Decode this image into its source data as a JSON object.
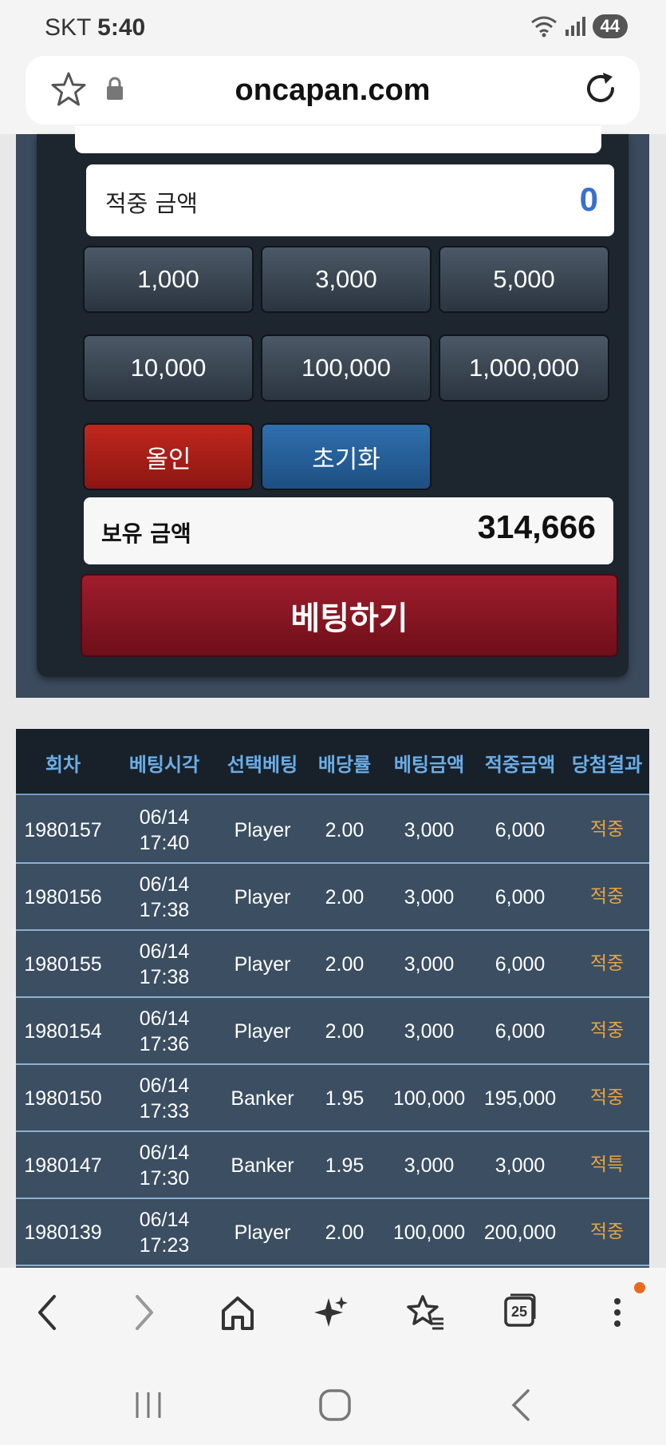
{
  "status": {
    "carrier": "SKT",
    "time": "5:40",
    "battery": "44"
  },
  "browser": {
    "domain": "oncapan.com"
  },
  "bet": {
    "win_label": "적중 금액",
    "win_value": "0",
    "chips": [
      "1,000",
      "3,000",
      "5,000",
      "10,000",
      "100,000",
      "1,000,000"
    ],
    "allin_label": "올인",
    "reset_label": "초기화",
    "balance_label": "보유 금액",
    "balance_value": "314,666",
    "bet_button": "베팅하기"
  },
  "history": {
    "headers": [
      "회차",
      "베팅시각",
      "선택베팅",
      "배당률",
      "베팅금액",
      "적중금액",
      "당첨결과"
    ],
    "rows": [
      {
        "round": "1980157",
        "date": "06/14",
        "time": "17:40",
        "pick": "Player",
        "odds": "2.00",
        "bet": "3,000",
        "win": "6,000",
        "result": "적중"
      },
      {
        "round": "1980156",
        "date": "06/14",
        "time": "17:38",
        "pick": "Player",
        "odds": "2.00",
        "bet": "3,000",
        "win": "6,000",
        "result": "적중"
      },
      {
        "round": "1980155",
        "date": "06/14",
        "time": "17:38",
        "pick": "Player",
        "odds": "2.00",
        "bet": "3,000",
        "win": "6,000",
        "result": "적중"
      },
      {
        "round": "1980154",
        "date": "06/14",
        "time": "17:36",
        "pick": "Player",
        "odds": "2.00",
        "bet": "3,000",
        "win": "6,000",
        "result": "적중"
      },
      {
        "round": "1980150",
        "date": "06/14",
        "time": "17:33",
        "pick": "Banker",
        "odds": "1.95",
        "bet": "100,000",
        "win": "195,000",
        "result": "적중"
      },
      {
        "round": "1980147",
        "date": "06/14",
        "time": "17:30",
        "pick": "Banker",
        "odds": "1.95",
        "bet": "3,000",
        "win": "3,000",
        "result": "적특"
      },
      {
        "round": "1980139",
        "date": "06/14",
        "time": "17:23",
        "pick": "Player",
        "odds": "2.00",
        "bet": "100,000",
        "win": "200,000",
        "result": "적중"
      }
    ]
  },
  "nav": {
    "tabs_count": "25"
  },
  "colors": {
    "accent_blue": "#3a6fd0",
    "result_orange": "#e8a440",
    "header_blue": "#6aaee8",
    "bet_red": "#a01d2c"
  }
}
